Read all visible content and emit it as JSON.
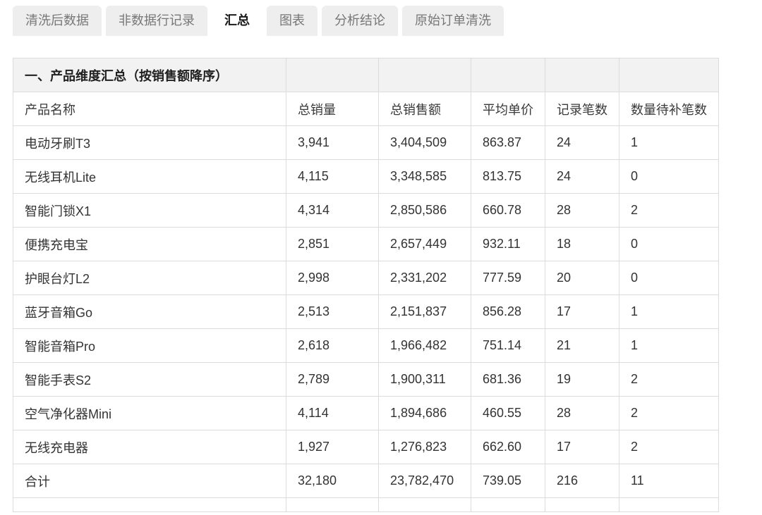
{
  "tabs": [
    {
      "label": "清洗后数据",
      "active": false
    },
    {
      "label": "非数据行记录",
      "active": false
    },
    {
      "label": "汇总",
      "active": true
    },
    {
      "label": "图表",
      "active": false
    },
    {
      "label": "分析结论",
      "active": false
    },
    {
      "label": "原始订单清洗",
      "active": false
    }
  ],
  "section_title": "一、产品维度汇总（按销售额降序）",
  "headers": [
    "产品名称",
    "总销量",
    "总销售额",
    "平均单价",
    "记录笔数",
    "数量待补笔数"
  ],
  "rows": [
    [
      "电动牙刷T3",
      "3,941",
      "3,404,509",
      "863.87",
      "24",
      "1"
    ],
    [
      "无线耳机Lite",
      "4,115",
      "3,348,585",
      "813.75",
      "24",
      "0"
    ],
    [
      "智能门锁X1",
      "4,314",
      "2,850,586",
      "660.78",
      "28",
      "2"
    ],
    [
      "便携充电宝",
      "2,851",
      "2,657,449",
      "932.11",
      "18",
      "0"
    ],
    [
      "护眼台灯L2",
      "2,998",
      "2,331,202",
      "777.59",
      "20",
      "0"
    ],
    [
      "蓝牙音箱Go",
      "2,513",
      "2,151,837",
      "856.28",
      "17",
      "1"
    ],
    [
      "智能音箱Pro",
      "2,618",
      "1,966,482",
      "751.14",
      "21",
      "1"
    ],
    [
      "智能手表S2",
      "2,789",
      "1,900,311",
      "681.36",
      "19",
      "2"
    ],
    [
      "空气净化器Mini",
      "4,114",
      "1,894,686",
      "460.55",
      "28",
      "2"
    ],
    [
      "无线充电器",
      "1,927",
      "1,276,823",
      "662.60",
      "17",
      "2"
    ],
    [
      "合计",
      "32,180",
      "23,782,470",
      "739.05",
      "216",
      "11"
    ]
  ]
}
